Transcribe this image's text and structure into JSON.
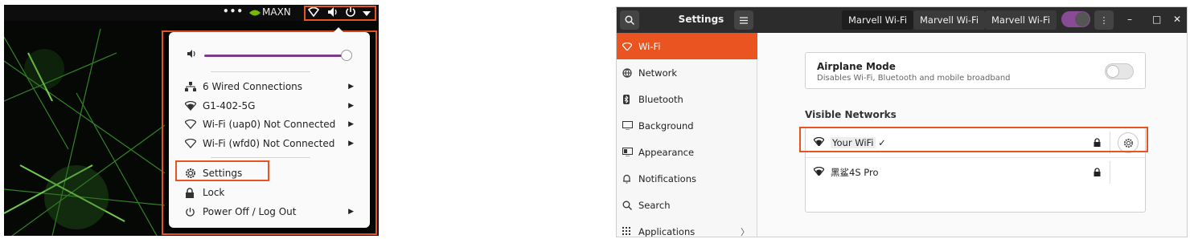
{
  "topbar": {
    "dots": "•••",
    "perf_mode": "MAXN"
  },
  "system_menu": {
    "items": [
      {
        "label": "6 Wired Connections",
        "icon": "network-wired-icon"
      },
      {
        "label": "G1-402-5G",
        "icon": "wifi-icon"
      },
      {
        "label": "Wi-Fi (uap0) Not Connected",
        "icon": "wifi-outline-icon"
      },
      {
        "label": "Wi-Fi (wfd0) Not Connected",
        "icon": "wifi-outline-icon"
      },
      {
        "label": "Settings",
        "icon": "gear-icon"
      },
      {
        "label": "Lock",
        "icon": "lock-icon"
      },
      {
        "label": "Power Off / Log Out",
        "icon": "power-icon"
      }
    ],
    "volume_level": 0.98
  },
  "settings": {
    "title": "Settings",
    "tabs": [
      "Marvell Wi-Fi",
      "Marvell Wi-Fi",
      "Marvell Wi-Fi"
    ],
    "active_tab_index": 0,
    "sidebar": [
      {
        "label": "Wi-Fi",
        "icon": "wifi-icon"
      },
      {
        "label": "Network",
        "icon": "network-icon"
      },
      {
        "label": "Bluetooth",
        "icon": "bluetooth-icon"
      },
      {
        "label": "Background",
        "icon": "background-icon"
      },
      {
        "label": "Appearance",
        "icon": "appearance-icon"
      },
      {
        "label": "Notifications",
        "icon": "bell-icon"
      },
      {
        "label": "Search",
        "icon": "search-icon"
      },
      {
        "label": "Applications",
        "icon": "apps-grid-icon"
      }
    ],
    "active_sidebar_index": 0,
    "airplane": {
      "title": "Airplane Mode",
      "subtitle": "Disables Wi-Fi, Bluetooth and mobile broadband",
      "enabled": false
    },
    "visible_networks_heading": "Visible Networks",
    "networks": [
      {
        "name": "Your WiFi",
        "connected": true,
        "secured": true
      },
      {
        "name": "黑鲨4S Pro",
        "connected": false,
        "secured": true
      }
    ],
    "accent_color": "#e95420"
  }
}
